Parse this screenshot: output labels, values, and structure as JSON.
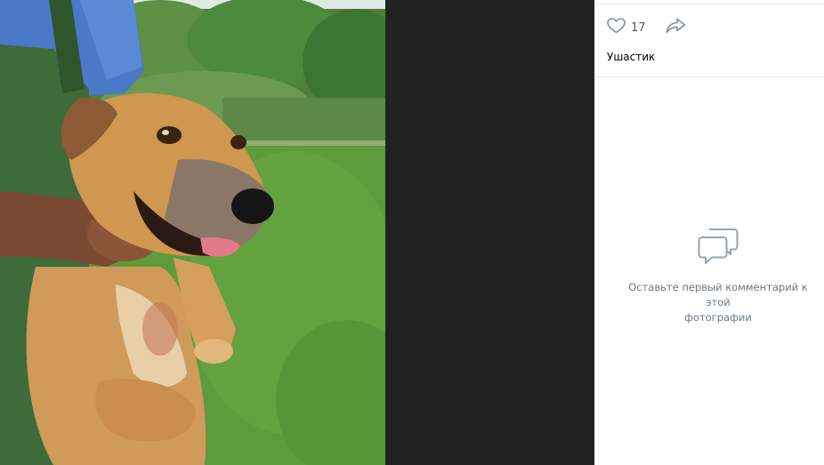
{
  "photo": {
    "subject": "dog-photo"
  },
  "post": {
    "likes_count": "17",
    "album_name": "Ушастик"
  },
  "comments": {
    "empty_line1": "Оставьте первый комментарий к этой",
    "empty_line2": "фотографии"
  },
  "icons": {
    "like": "heart-icon",
    "share": "share-arrow-icon",
    "comments_empty": "comments-icon"
  },
  "colors": {
    "icon": "#818c99",
    "muted_text": "#6d7885",
    "backdrop": "#222222"
  }
}
